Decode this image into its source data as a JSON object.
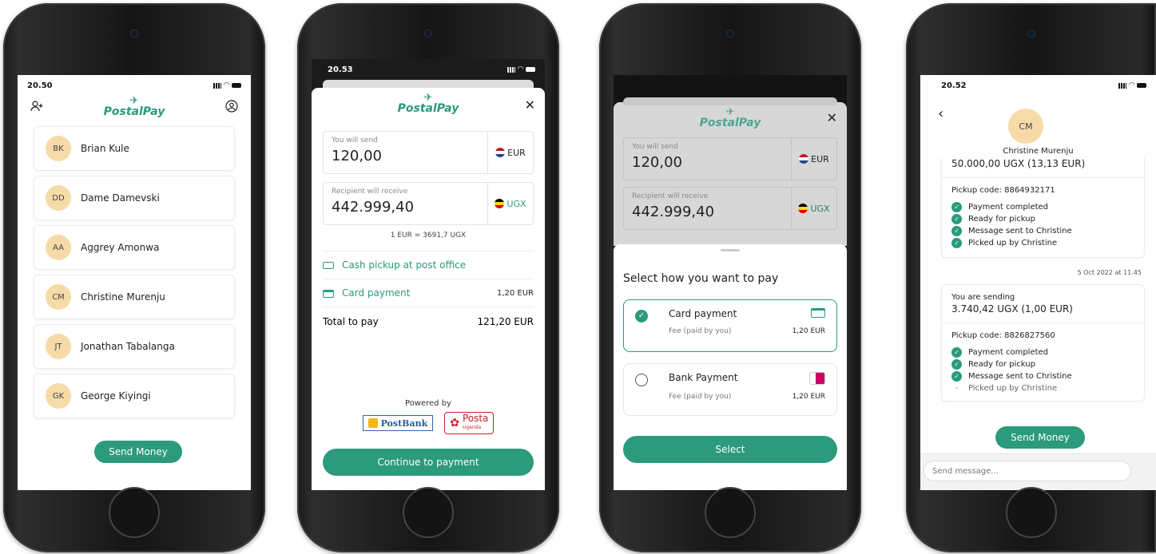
{
  "screen1": {
    "time": "20.50",
    "logo": "PostalPay",
    "contacts": [
      {
        "initials": "BK",
        "name": "Brian Kule"
      },
      {
        "initials": "DD",
        "name": "Dame Damevski"
      },
      {
        "initials": "AA",
        "name": "Aggrey Amonwa"
      },
      {
        "initials": "CM",
        "name": "Christine Murenju"
      },
      {
        "initials": "JT",
        "name": "Jonathan Tabalanga"
      },
      {
        "initials": "GK",
        "name": "George Kiyingi"
      }
    ],
    "send_money": "Send Money"
  },
  "screen2": {
    "time": "20.53",
    "logo": "PostalPay",
    "send_label": "You will send",
    "send_value": "120,00",
    "send_currency": "EUR",
    "receive_label": "Recipient will receive",
    "receive_value": "442.999,40",
    "receive_currency": "UGX",
    "rate": "1 EUR = 3691,7 UGX",
    "cash_pickup": "Cash pickup at post office",
    "card_payment": "Card payment",
    "card_fee": "1,20 EUR",
    "total_label": "Total to pay",
    "total_value": "121,20 EUR",
    "powered_by": "Powered by",
    "postbank": "PostBank",
    "posta": "Posta",
    "posta_sub": "Uganda",
    "continue": "Continue to payment"
  },
  "screen3": {
    "logo": "PostalPay",
    "send_label": "You will send",
    "send_value": "120,00",
    "send_currency": "EUR",
    "receive_label": "Recipient will receive",
    "receive_value": "442.999,40",
    "receive_currency": "UGX",
    "title": "Select how you want to pay",
    "options": [
      {
        "name": "Card payment",
        "fee_label": "Fee (paid by you)",
        "fee": "1,20 EUR"
      },
      {
        "name": "Bank Payment",
        "fee_label": "Fee (paid by you)",
        "fee": "1,20 EUR"
      }
    ],
    "select": "Select"
  },
  "screen4": {
    "time": "20.52",
    "initials": "CM",
    "name": "Christine Murenju",
    "msg1_amount": "50.000,00 UGX (13,13 EUR)",
    "msg1_code": "Pickup code: 8864932171",
    "msg1_steps": [
      "Payment completed",
      "Ready for pickup",
      "Message sent to Christine",
      "Picked up by Christine"
    ],
    "timestamp": "5 Oct 2022 at 11.45",
    "msg2_title": "You are sending",
    "msg2_amount": "3.740,42 UGX (1,00 EUR)",
    "msg2_code": "Pickup code: 8826827560",
    "msg2_steps": [
      "Payment completed",
      "Ready for pickup",
      "Message sent to Christine",
      "Picked up by Christine"
    ],
    "send_money": "Send Money",
    "placeholder": "Send message..."
  },
  "colors": {
    "accent": "#2b9a7d",
    "avatar": "#f6dba8"
  }
}
